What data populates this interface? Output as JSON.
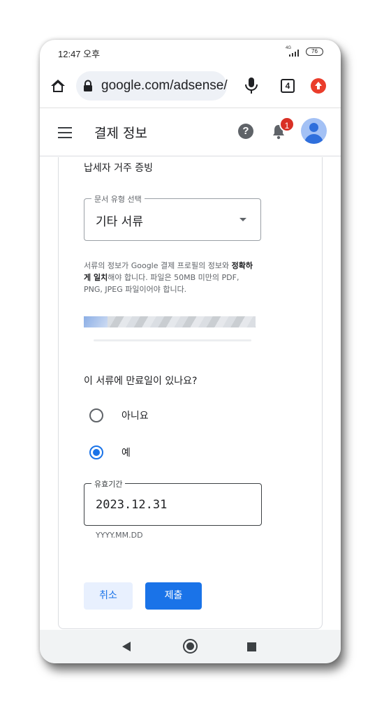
{
  "status_bar": {
    "time": "12:47 오후",
    "network": "4G",
    "battery": "76"
  },
  "browser": {
    "url": "google.com/adsense/",
    "tab_count": "4"
  },
  "header": {
    "title": "결제 정보",
    "notification_count": "1"
  },
  "form": {
    "section_title": "납세자 거주 증빙",
    "doc_type_label": "문서 유형 선택",
    "doc_type_value": "기타 서류",
    "info_prefix": "서류의 정보가 Google 결제 프로필의 정보와 ",
    "info_bold": "정확하게 일치",
    "info_suffix": "해야 합니다. 파일은 50MB 미만의 PDF, PNG, JPEG 파일이어야 합니다.",
    "expiry_question": "이 서류에 만료일이 있나요?",
    "options": [
      {
        "label": "아니요",
        "selected": false
      },
      {
        "label": "예",
        "selected": true
      }
    ],
    "expiry_label": "유효기간",
    "expiry_value": "2023.12.31",
    "expiry_hint": "YYYY.MM.DD"
  },
  "buttons": {
    "cancel": "취소",
    "submit": "제출"
  },
  "colors": {
    "accent": "#1a73e8",
    "badge": "#d93025",
    "update": "#ea3d2b"
  }
}
